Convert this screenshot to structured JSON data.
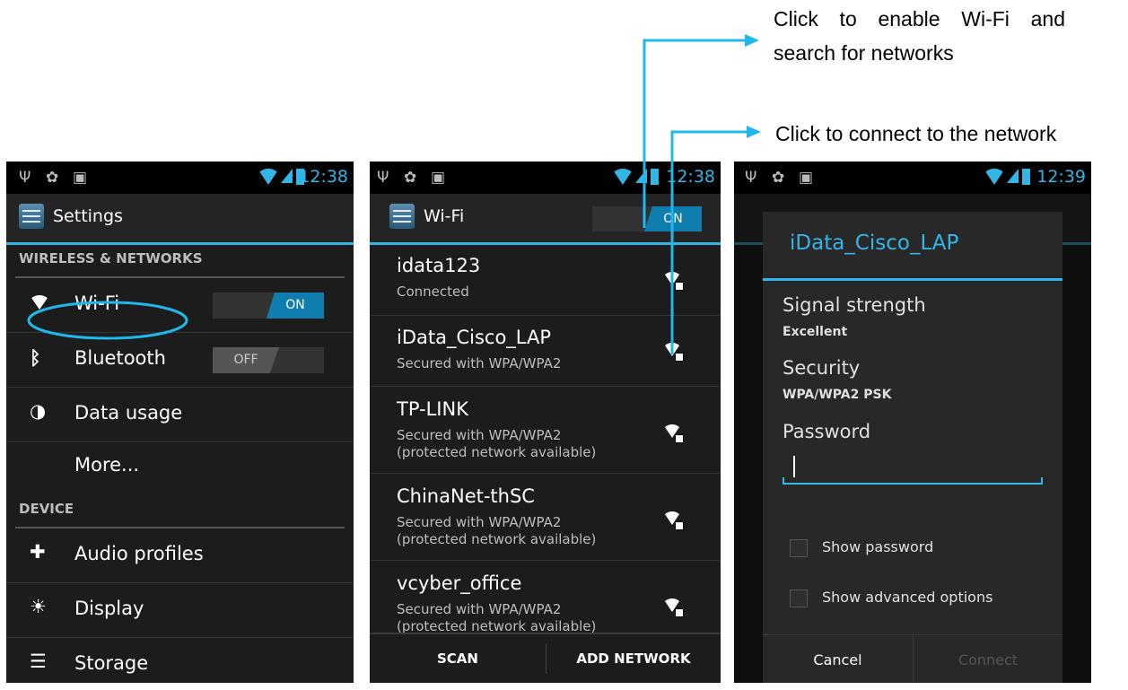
{
  "annotations": {
    "enable_wifi": [
      "Click to enable Wi-Fi and",
      "search for networks"
    ],
    "connect": "Click to connect to the network"
  },
  "colors": {
    "accent": "#33b5e5",
    "background": "#000000",
    "arrow": "#1fb8ec"
  },
  "screen1": {
    "status_time": "12:38",
    "title": "Settings",
    "header_wireless": "WIRELESS & NETWORKS",
    "items": [
      {
        "icon": "wifi-icon",
        "label": "Wi-Fi",
        "toggle": "ON"
      },
      {
        "icon": "bluetooth-icon",
        "label": "Bluetooth",
        "toggle": "OFF"
      },
      {
        "icon": "data-usage-icon",
        "label": "Data usage"
      },
      {
        "label": "More..."
      }
    ],
    "header_device": "DEVICE",
    "device_items": [
      {
        "icon": "audio-profiles-icon",
        "label": "Audio profiles"
      },
      {
        "icon": "display-icon",
        "label": "Display"
      },
      {
        "icon": "storage-icon",
        "label": "Storage"
      }
    ]
  },
  "screen2": {
    "status_time": "12:38",
    "title": "Wi-Fi",
    "toggle": "ON",
    "networks": [
      {
        "name": "idata123",
        "status": "Connected"
      },
      {
        "name": "iData_Cisco_LAP",
        "status": "Secured with WPA/WPA2"
      },
      {
        "name": "TP-LINK",
        "status": "Secured with WPA/WPA2",
        "status2": "(protected network available)"
      },
      {
        "name": "ChinaNet-thSC",
        "status": "Secured with WPA/WPA2",
        "status2": "(protected network available)"
      },
      {
        "name": "vcyber_office",
        "status": "Secured with WPA/WPA2",
        "status2": "(protected network available)"
      }
    ],
    "scan_label": "SCAN",
    "add_network_label": "ADD NETWORK"
  },
  "screen3": {
    "status_time": "12:39",
    "dialog_title": "iData_Cisco_LAP",
    "signal_label": "Signal strength",
    "signal_value": "Excellent",
    "security_label": "Security",
    "security_value": "WPA/WPA2 PSK",
    "password_label": "Password",
    "password_value": "",
    "show_password": "Show password",
    "show_advanced": "Show advanced options",
    "cancel_label": "Cancel",
    "connect_label": "Connect"
  }
}
